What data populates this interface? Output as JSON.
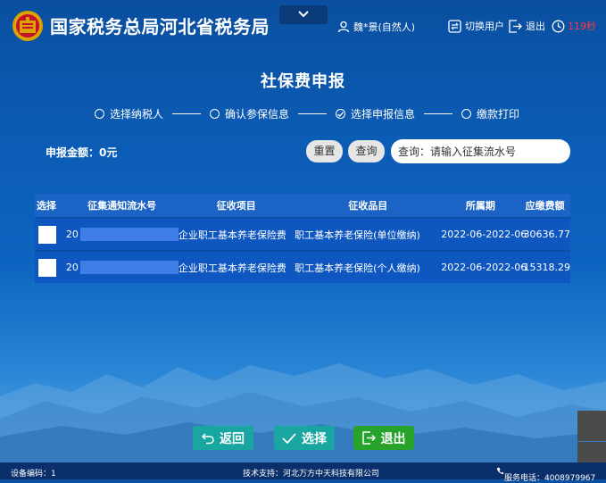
{
  "header": {
    "org_title": "国家税务总局河北省税务局",
    "user": "魏*景(自然人)",
    "switch_user": "切换用户",
    "logout": "退出",
    "countdown": "119秒"
  },
  "page": {
    "title": "社保费申报",
    "steps": [
      {
        "label": "选择纳税人",
        "checked": false
      },
      {
        "label": "确认参保信息",
        "checked": false
      },
      {
        "label": "选择申报信息",
        "checked": true
      },
      {
        "label": "缴款打印",
        "checked": false
      }
    ],
    "amount_label": "申报金额：0元"
  },
  "toolbar": {
    "reset": "重置",
    "query": "查询",
    "search_placeholder": "查询：请输入征集流水号"
  },
  "table": {
    "headers": [
      "选择",
      "征集通知流水号",
      "征收项目",
      "征收品目",
      "所属期",
      "应缴费额"
    ],
    "rows": [
      {
        "serial_prefix": "20",
        "item": "企业职工基本养老保险费",
        "subitem": "职工基本养老保险(单位缴纳)",
        "period": "2022-06-2022-06",
        "amount": "30636.77"
      },
      {
        "serial_prefix": "20",
        "item": "企业职工基本养老保险费",
        "subitem": "职工基本养老保险(个人缴纳)",
        "period": "2022-06-2022-06",
        "amount": "15318.29"
      }
    ]
  },
  "actions": {
    "back": "返回",
    "select": "选择",
    "exit": "退出"
  },
  "footer": {
    "device": "设备编码：1",
    "support": "技术支持：河北万方中天科技有限公司",
    "hotline": "服务电话：4008979967"
  },
  "colors": {
    "accent_teal": "#1aa6a0",
    "accent_green": "#27a22b",
    "countdown_red": "#ff3b3b"
  }
}
